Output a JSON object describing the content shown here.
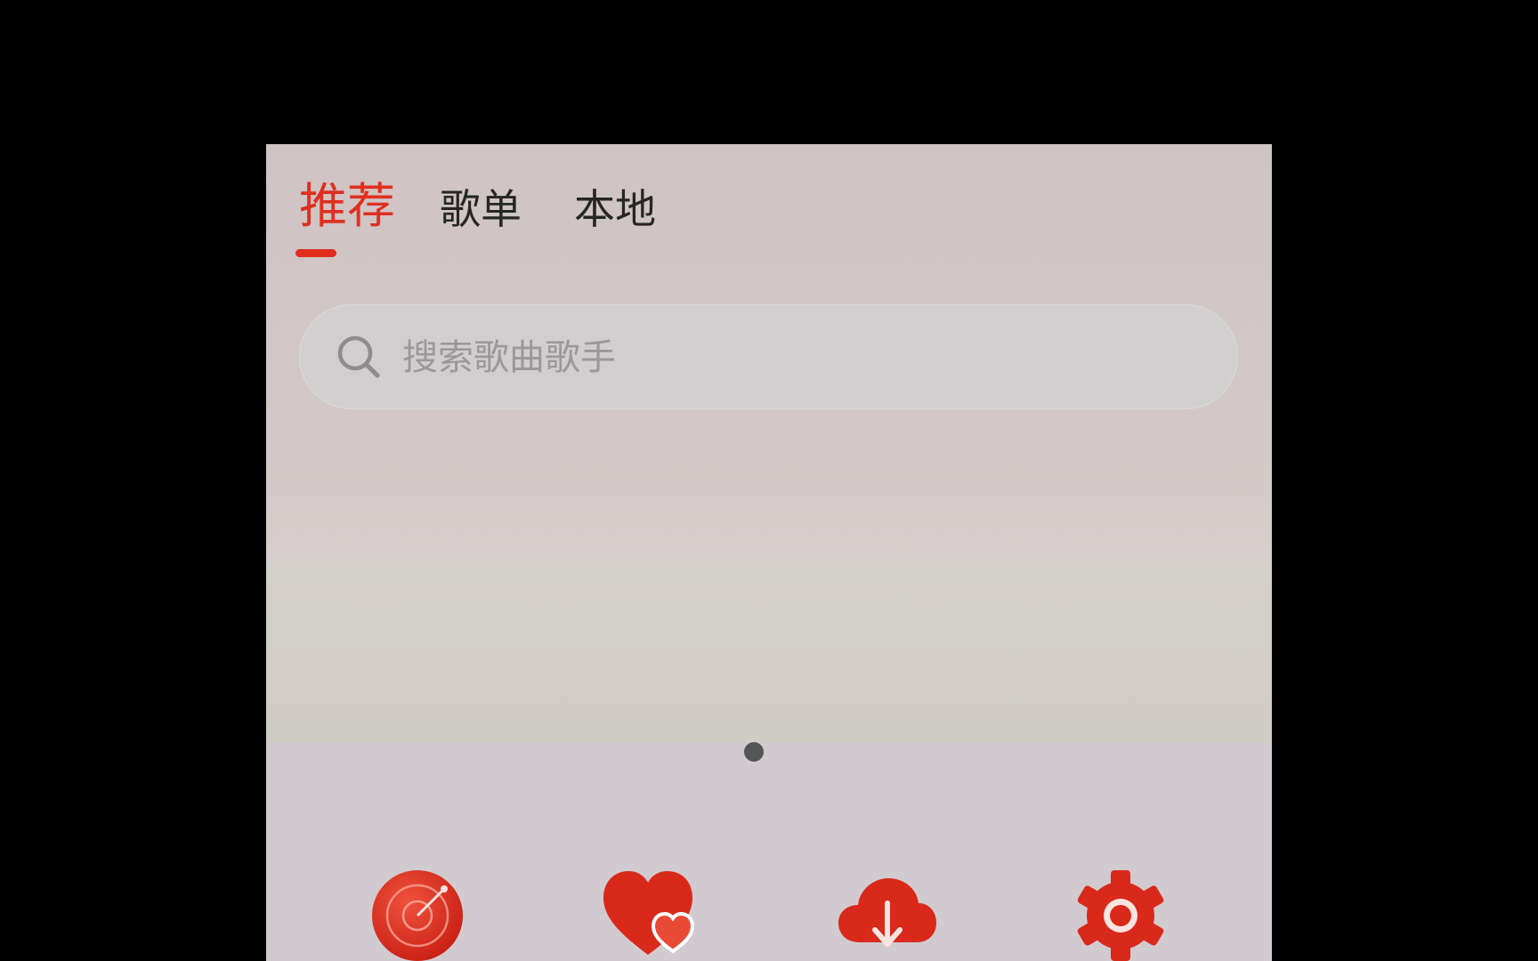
{
  "tabs": [
    {
      "label": "推荐",
      "active": true
    },
    {
      "label": "歌单",
      "active": false
    },
    {
      "label": "本地",
      "active": false
    }
  ],
  "search": {
    "placeholder": "搜索歌曲歌手"
  },
  "banner": {
    "page_indicator_count": 1,
    "active_page": 1
  },
  "quick_entries": [
    {
      "icon": "radar-icon"
    },
    {
      "icon": "heart-icon"
    },
    {
      "icon": "cloud-download-icon"
    },
    {
      "icon": "gear-icon"
    }
  ],
  "colors": {
    "accent": "#e02f1f",
    "tab_text": "#262626",
    "placeholder": "#9a9898",
    "background": "#d2c7c6"
  }
}
